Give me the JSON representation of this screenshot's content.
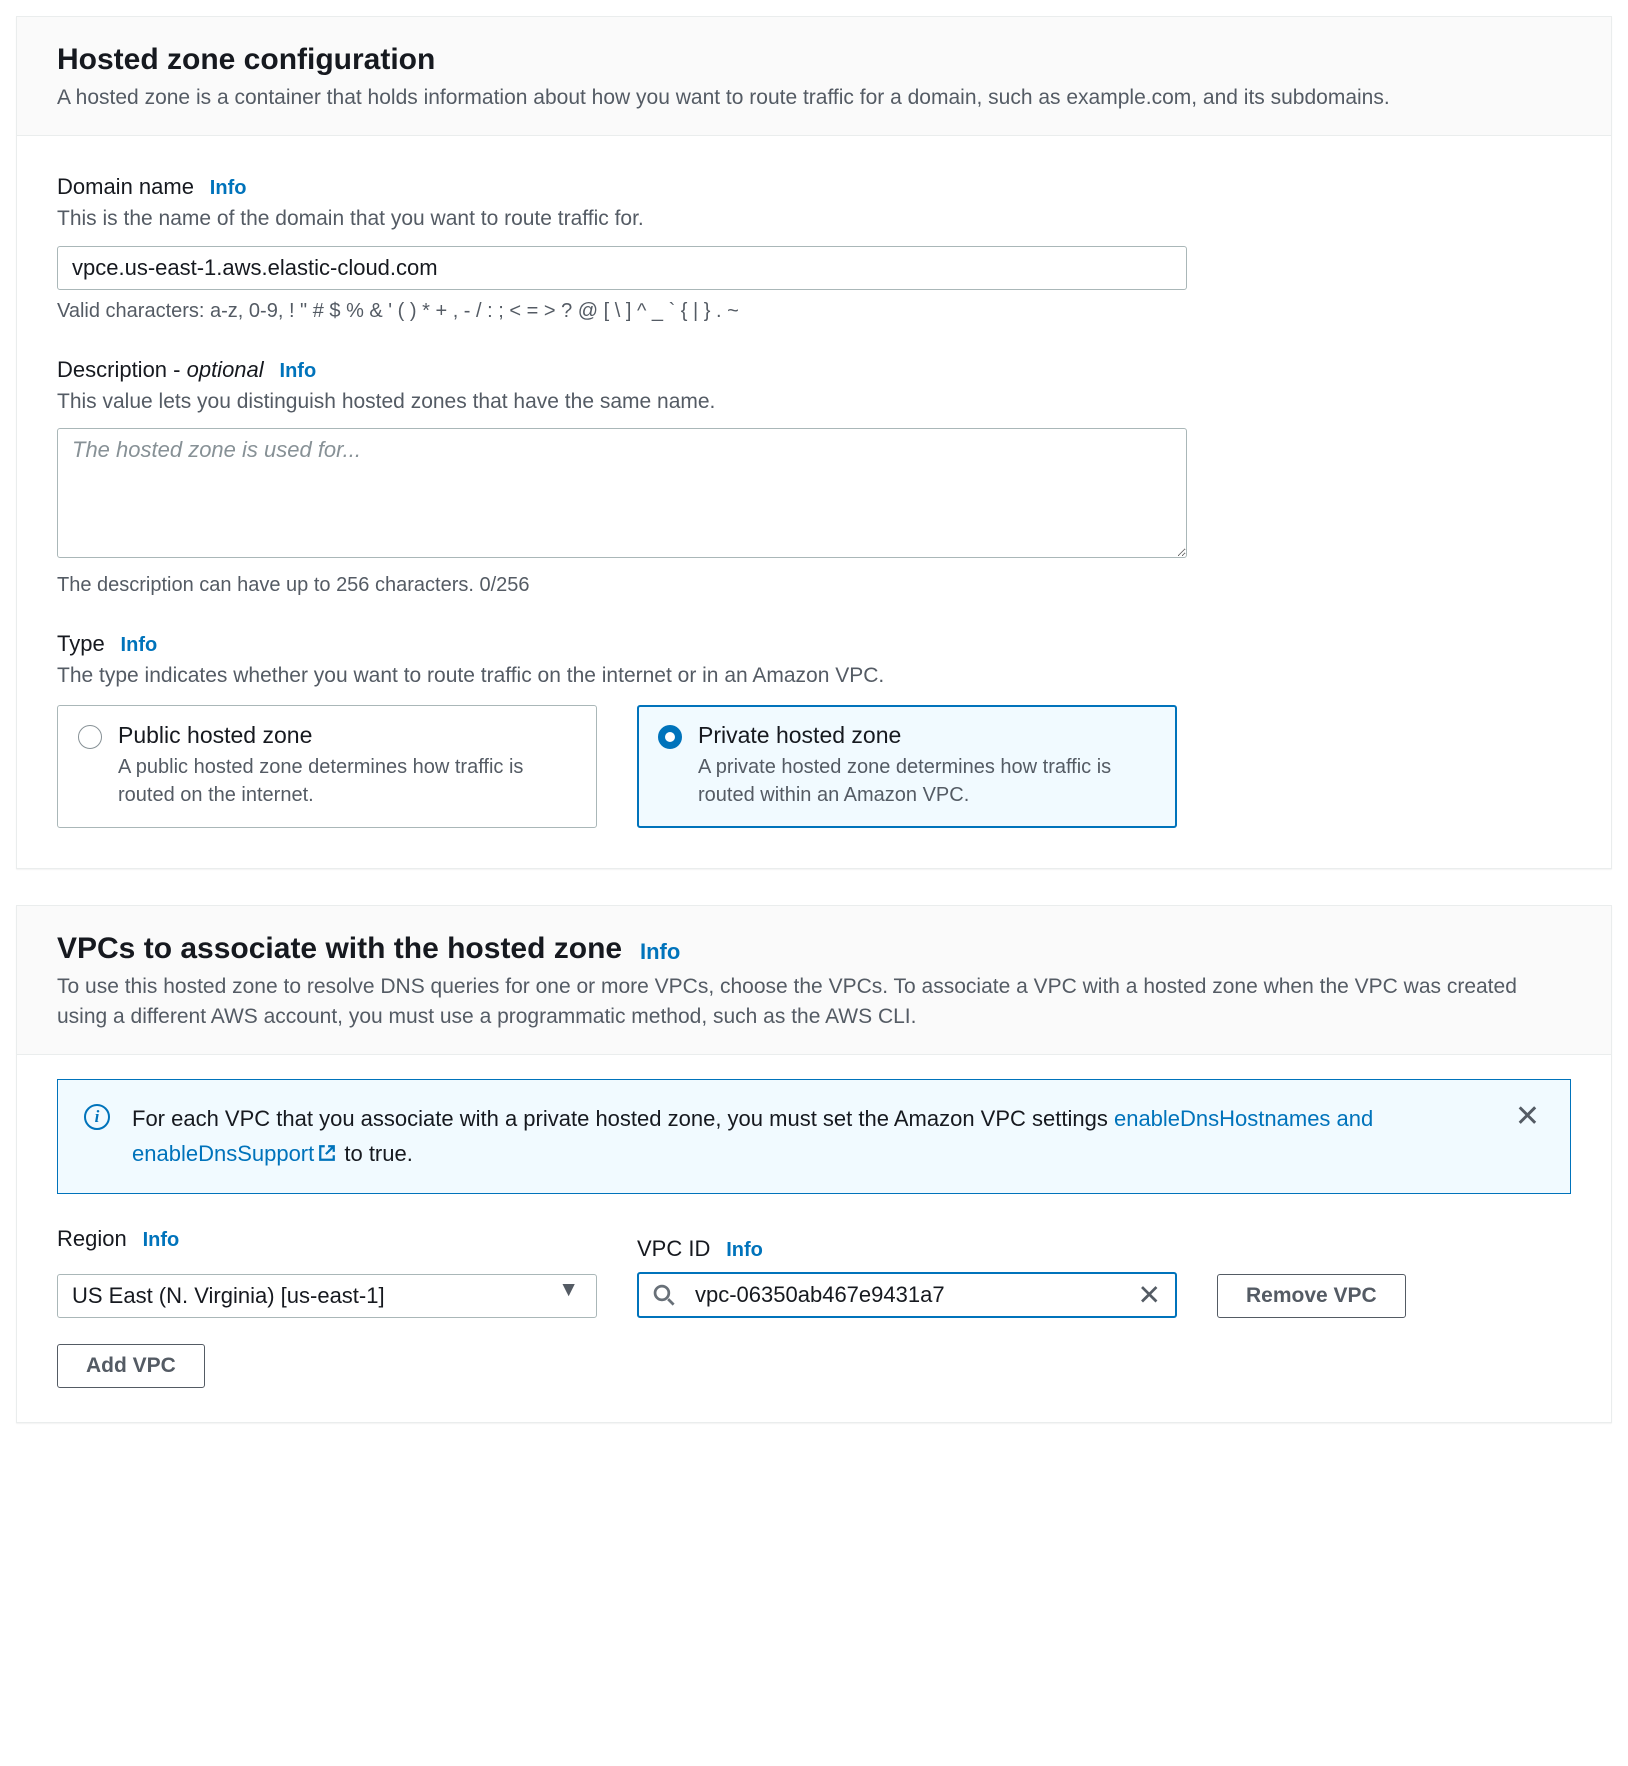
{
  "info_label": "Info",
  "section1": {
    "title": "Hosted zone configuration",
    "desc": "A hosted zone is a container that holds information about how you want to route traffic for a domain, such as example.com, and its subdomains."
  },
  "domain": {
    "label": "Domain name",
    "hint": "This is the name of the domain that you want to route traffic for.",
    "value": "vpce.us-east-1.aws.elastic-cloud.com",
    "constraint": "Valid characters: a-z, 0-9, ! \" # $ % & ' ( ) * + , - / : ; < = > ? @ [ \\ ] ^ _ ` { | } . ~"
  },
  "description": {
    "label_main": "Description - ",
    "label_optional": "optional",
    "hint": "This value lets you distinguish hosted zones that have the same name.",
    "placeholder": "The hosted zone is used for...",
    "value": "",
    "counter": "The description can have up to 256 characters. 0/256"
  },
  "type": {
    "label": "Type",
    "hint": "The type indicates whether you want to route traffic on the internet or in an Amazon VPC.",
    "public": {
      "title": "Public hosted zone",
      "desc": "A public hosted zone determines how traffic is routed on the internet."
    },
    "private": {
      "title": "Private hosted zone",
      "desc": "A private hosted zone determines how traffic is routed within an Amazon VPC."
    }
  },
  "section2": {
    "title": "VPCs to associate with the hosted zone",
    "desc": "To use this hosted zone to resolve DNS queries for one or more VPCs, choose the VPCs. To associate a VPC with a hosted zone when the VPC was created using a different AWS account, you must use a programmatic method, such as the AWS CLI."
  },
  "alert": {
    "text1": "For each VPC that you associate with a private hosted zone, you must set the Amazon VPC settings ",
    "link": "enableDnsHostnames and enableDnsSupport",
    "text2": " to true."
  },
  "region": {
    "label": "Region",
    "value": "US East (N. Virginia) [us-east-1]"
  },
  "vpcid": {
    "label": "VPC ID",
    "value": "vpc-06350ab467e9431a7"
  },
  "buttons": {
    "remove_vpc": "Remove VPC",
    "add_vpc": "Add VPC"
  }
}
